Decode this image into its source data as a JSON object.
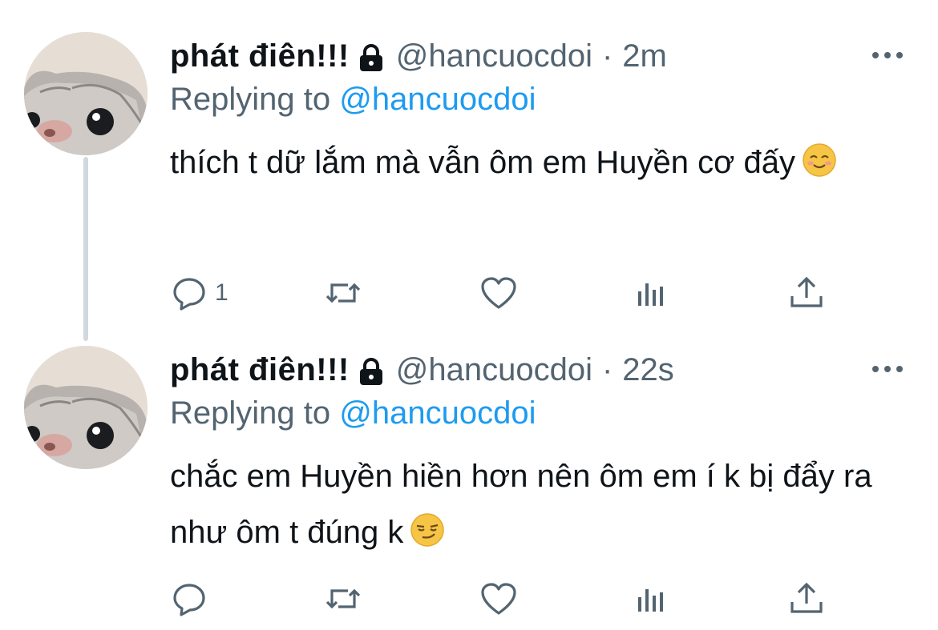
{
  "tweets": [
    {
      "display_name": "phát điên!!!",
      "handle": "@hancuocdoi",
      "separator": "·",
      "time": "2m",
      "replying_prefix": "Replying to",
      "replying_handle": "@hancuocdoi",
      "text": "thích t dữ lắm mà vẫn ôm em Huyền cơ đấy",
      "emoji_icon": "smiling-face-icon",
      "reply_count": "1"
    },
    {
      "display_name": "phát điên!!!",
      "handle": "@hancuocdoi",
      "separator": "·",
      "time": "22s",
      "replying_prefix": "Replying to",
      "replying_handle": "@hancuocdoi",
      "text": "chắc em Huyền hiền hơn nên ôm em í k bị đẩy ra như ôm t đúng k",
      "emoji_icon": "smirking-face-icon",
      "reply_count": ""
    }
  ],
  "colors": {
    "link": "#1d9bf0",
    "secondary_text": "#536471",
    "thread_line": "#cfd9de",
    "emoji": "#f7c545"
  }
}
